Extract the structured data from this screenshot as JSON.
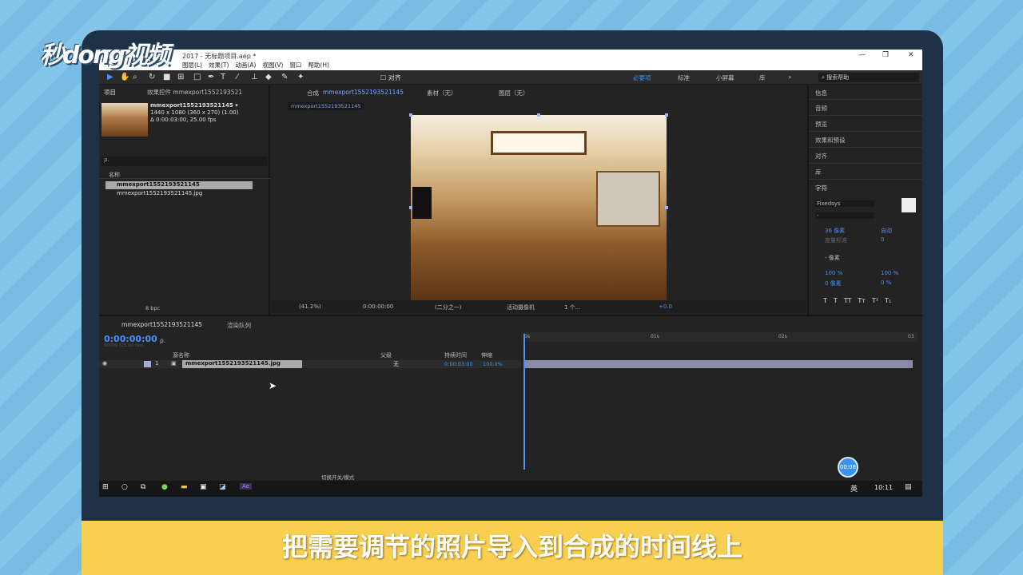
{
  "brand": {
    "logo_text": "秒dong视频"
  },
  "window": {
    "title": "2017 - 无标题项目.aep *",
    "menus": [
      "图层(L)",
      "效果(T)",
      "动画(A)",
      "视图(V)",
      "窗口",
      "帮助(H)"
    ],
    "controls": [
      "—",
      "❐",
      "✕"
    ]
  },
  "toolbar": {
    "align_label": "对齐",
    "workspaces": [
      "必要项",
      "标准",
      "小屏幕",
      "库"
    ],
    "active_workspace": "必要项",
    "search_placeholder": "搜索帮助"
  },
  "project_panel": {
    "tab_project": "项目",
    "tab_effects": "效果控件 mmexport1552193521",
    "item_name": "mmexport1552193521145 ▾",
    "item_size": "1440 x 1080 (360 x 270) (1.00)",
    "item_duration": "Δ 0:00:03:00, 25.00 fps",
    "search_placeholder": "ρ.",
    "col_name": "名称",
    "rows": [
      "mmexport1552193521145",
      "mmexport1552193521145.jpg"
    ],
    "bpc": "8 bpc"
  },
  "comp_panel": {
    "tab_label": "合成",
    "tab_name": "mmexport1552193521145",
    "footage_tab": "素材（无）",
    "layer_tab": "图层（无）",
    "sub_tab": "mmexport1552193521145",
    "zoom": "(41.2%)",
    "timecode": "0:00:00:00",
    "resolution": "(二分之一)",
    "camera": "活动摄像机",
    "views": "1 个...",
    "exposure": "+0.0"
  },
  "right_panel": {
    "items": [
      "信息",
      "音频",
      "预览",
      "效果和预设",
      "对齐",
      "库"
    ],
    "character_title": "字符",
    "font": "Fixedsys",
    "font_style": "-",
    "font_size": "36 像素",
    "leading": "自动",
    "kerning": "度量标准",
    "tracking": "0",
    "stroke": "- 像素",
    "vscale": "100 %",
    "hscale": "100 %",
    "baseline": "0 像素",
    "tsume": "0 %",
    "styles": [
      "T",
      "T",
      "TT",
      "Tт",
      "T¹",
      "T₁"
    ]
  },
  "timeline": {
    "tab_name": "mmexport1552193521145",
    "render_queue": "渲染队列",
    "timecode": "0:00:00:00",
    "frames": "00000 (25.00 fps)",
    "search_placeholder": "ρ.",
    "col_source": "源名称",
    "col_parent": "父级",
    "col_duration": "持续时间",
    "col_stretch": "伸缩",
    "layer_index": "1",
    "layer_name": "mmexport1552193521145.jpg",
    "parent_value": "无",
    "duration": "0:00:03:00",
    "stretch": "100.0%",
    "ruler": [
      "0s",
      "01s",
      "02s",
      "03"
    ],
    "toggle_modes": "切换开关/模式"
  },
  "taskbar": {
    "ime": "英",
    "clock": "10:11"
  },
  "overlay": {
    "timer": "00:08"
  },
  "subtitle": "把需要调节的照片导入到合成的时间线上"
}
